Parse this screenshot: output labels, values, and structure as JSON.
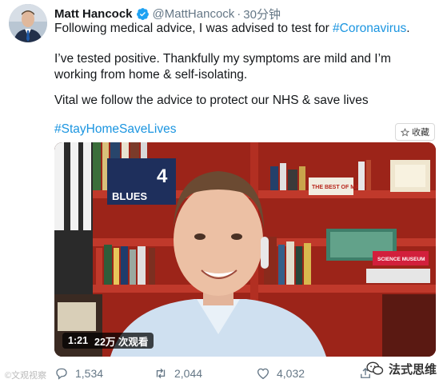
{
  "tweet": {
    "author_name": "Matt Hancock",
    "handle": "@MattHancock",
    "separator": "·",
    "time": "30分钟",
    "line1_prefix": "Following medical advice, I was advised to test for ",
    "line1_hashtag": "#Coronavirus",
    "line1_suffix": ".",
    "para2": "I’ve tested positive. Thankfully my symptoms are mild and I’m working from home & self-isolating.",
    "para3": "Vital we follow the advice to protect our NHS & save lives",
    "hashtag2": "#StayHomeSaveLives"
  },
  "collect_button": {
    "label": "收藏",
    "icon": "star-icon"
  },
  "video": {
    "duration": "1:21",
    "views": "22万 次观看",
    "shelf_items": [
      "BLUES",
      "THE BEST OF MATT",
      "SCIENCE MUSEUM"
    ]
  },
  "actions": {
    "replies": "1,534",
    "retweets": "2,044",
    "likes": "4,032"
  },
  "watermark_left": "©文观视察",
  "watermark_right": "法式思维",
  "colors": {
    "link": "#1b95e0",
    "verified": "#1da1f2",
    "muted": "#657786",
    "shelf_red": "#a3231a"
  }
}
